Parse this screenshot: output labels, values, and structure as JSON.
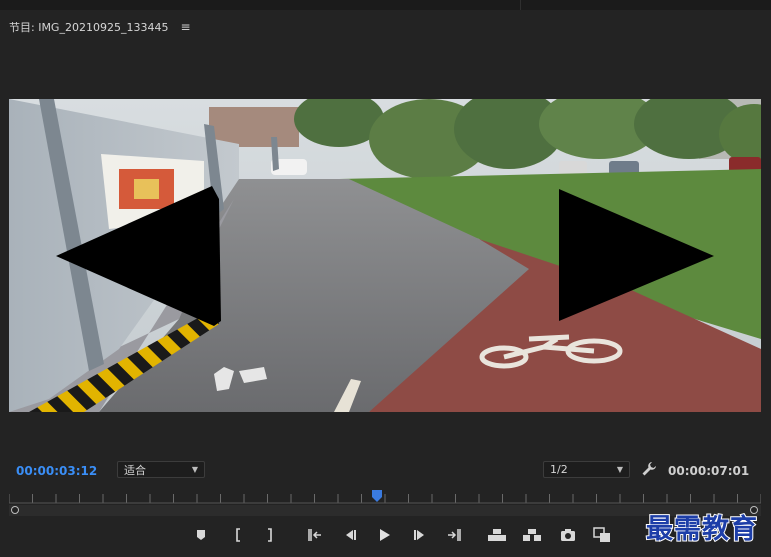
{
  "panel": {
    "title": "节目: IMG_20210925_133445",
    "menu_icon": "hamburger-menu-icon"
  },
  "playback": {
    "current_timecode": "00:00:03:12",
    "duration_timecode": "00:00:07:01",
    "fit_label": "适合",
    "resolution_label": "1/2",
    "playhead_position_fraction": 0.49
  },
  "controls": [
    {
      "name": "add-marker-button",
      "icon": "marker-icon"
    },
    {
      "name": "mark-in-button",
      "icon": "mark-in-icon"
    },
    {
      "name": "mark-out-button",
      "icon": "mark-out-icon"
    },
    {
      "name": "go-to-in-button",
      "icon": "go-to-in-icon"
    },
    {
      "name": "step-back-button",
      "icon": "step-back-icon"
    },
    {
      "name": "play-button",
      "icon": "play-icon"
    },
    {
      "name": "step-forward-button",
      "icon": "step-forward-icon"
    },
    {
      "name": "go-to-out-button",
      "icon": "go-to-out-icon"
    },
    {
      "name": "lift-button",
      "icon": "lift-icon"
    },
    {
      "name": "extract-button",
      "icon": "extract-icon"
    },
    {
      "name": "export-frame-button",
      "icon": "camera-icon"
    },
    {
      "name": "comparison-view-button",
      "icon": "comparison-icon"
    }
  ],
  "watermark": "最需教育",
  "colors": {
    "accent_timecode": "#3a8ef6",
    "playhead": "#3a7be0",
    "background": "#232323"
  }
}
